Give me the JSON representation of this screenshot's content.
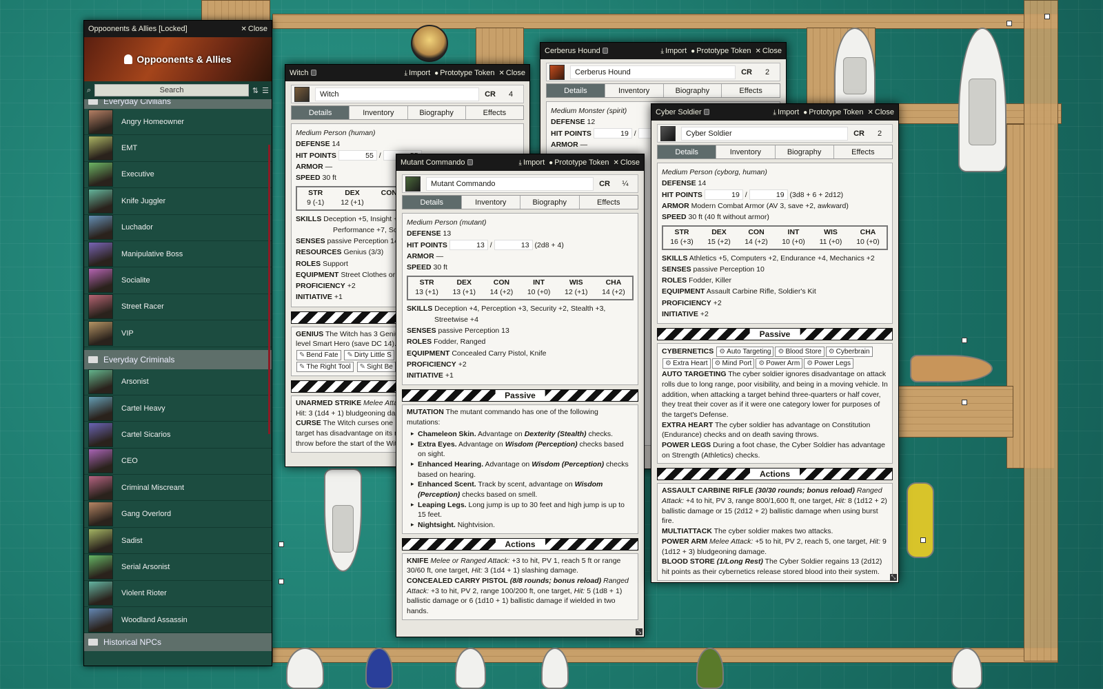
{
  "sidebar": {
    "title": "Oppoonents & Allies [Locked]",
    "close": "Close",
    "banner": "Oppoonents & Allies",
    "search_placeholder": "Search",
    "folder1": "Everyday Civilians",
    "civilians": [
      "Angry Homeowner",
      "EMT",
      "Executive",
      "Knife Juggler",
      "Luchador",
      "Manipulative Boss",
      "Socialite",
      "Street Racer",
      "VIP"
    ],
    "folder2": "Everyday Criminals",
    "criminals": [
      "Arsonist",
      "Cartel Heavy",
      "Cartel Sicarios",
      "CEO",
      "Criminal Miscreant",
      "Gang Overlord",
      "Sadist",
      "Serial Arsonist",
      "Violent Rioter",
      "Woodland Assassin"
    ],
    "folder3": "Historical NPCs"
  },
  "common": {
    "import": "Import",
    "prototype": "Prototype Token",
    "close": "Close",
    "cr": "CR",
    "tabs": [
      "Details",
      "Inventory",
      "Biography",
      "Effects"
    ]
  },
  "witch": {
    "title": "Witch",
    "name": "Witch",
    "cr": "4",
    "type": "Medium Person (human)",
    "defense": "14",
    "hp": "55",
    "hpmax": "55",
    "armor": "—",
    "speed": "30 ft",
    "abil": [
      [
        "STR",
        "9 (-1)"
      ],
      [
        "DEX",
        "12 (+1)"
      ],
      [
        "CON",
        ""
      ]
    ],
    "skills": "Deception +5, Insight +",
    "skills2": "Performance +7, Social",
    "senses": "passive Perception 14",
    "resources": "Genius (3/3)",
    "roles": "Support",
    "equipment": "Street Clothes or l",
    "proficiency": "+2",
    "initiative": "+1",
    "genius": "The Witch has 3 Genius",
    "genius2": "level Smart Hero (save DC 14). T",
    "chips": [
      "Bend Fate",
      "Dirty Little S",
      "The Right Tool",
      "Sight Be"
    ],
    "unarmed": "UNARMED STRIKE",
    "unarmed_t": "Melee Attac",
    "unarmed2": "Hit: 3 (1d4 + 1) bludgeoning da",
    "curse": "The Witch curses one",
    "curse2": "target has disadvantage on its n",
    "curse3": "throw before the start of the Wit"
  },
  "cerberus": {
    "title": "Cerberus Hound",
    "name": "Cerberus Hound",
    "cr": "2",
    "type": "Medium Monster (spirit)",
    "defense": "12",
    "hp": "19",
    "hpmax": "19",
    "armor": "—"
  },
  "mutant": {
    "title": "Mutant Commando",
    "name": "Mutant Commando",
    "cr": "¼",
    "type": "Medium Person (mutant)",
    "defense": "13",
    "hp": "13",
    "hpmax": "13",
    "hpdice": "(2d8 + 4)",
    "armor": "—",
    "speed": "30 ft",
    "abil": [
      [
        "STR",
        "13 (+1)"
      ],
      [
        "DEX",
        "13 (+1)"
      ],
      [
        "CON",
        "14 (+2)"
      ],
      [
        "INT",
        "10 (+0)"
      ],
      [
        "WIS",
        "12 (+1)"
      ],
      [
        "CHA",
        "14 (+2)"
      ]
    ],
    "skills": "Deception +4, Perception +3, Security +2, Stealth +3,",
    "skills2": "Streetwise +4",
    "senses": "passive Perception 13",
    "roles": "Fodder, Ranged",
    "equipment": "Concealed Carry Pistol, Knife",
    "proficiency": "+2",
    "initiative": "+1",
    "passive": "Passive",
    "mutation": "MUTATION",
    "mutation_t": "The mutant commando has one of the following mutations:",
    "muts": [
      [
        "Chameleon Skin.",
        "Advantage on ",
        "Dexterity (Stealth)",
        " checks."
      ],
      [
        "Extra Eyes.",
        "Advantage on ",
        "Wisdom (Perception)",
        " checks based on sight."
      ],
      [
        "Enhanced Hearing.",
        "Advantage on ",
        "Wisdom (Perception)",
        " checks based on hearing."
      ],
      [
        "Enhanced Scent.",
        "Track by scent, advantage on ",
        "Wisdom (Perception)",
        " checks based on smell."
      ],
      [
        "Leaping Legs.",
        "Long jump is up to 30 feet and high jump is up to 15 feet.",
        "",
        ""
      ],
      [
        "Nightsight.",
        "Nightvision.",
        "",
        ""
      ]
    ],
    "actions": "Actions",
    "knife": "KNIFE",
    "knife_t": "Melee or Ranged Attack:",
    "knife2": "+3 to hit, PV 1, reach 5 ft or range 30/60 ft, one target,",
    "knife3": "Hit:",
    "knife4": "3 (1d4 + 1) slashing damage.",
    "pistol": "CONCEALED CARRY PISTOL",
    "pistol_t": "(8/8 rounds; bonus reload)",
    "pistol_t2": "Ranged Attack:",
    "pistol2": "+3 to hit, PV 2, range 100/200 ft, one target,",
    "pistol3": "Hit:",
    "pistol4": "5 (1d8 + 1) ballistic damage or 6 (1d10 + 1) ballistic damage if wielded in two hands."
  },
  "cyber": {
    "title": "Cyber Soldier",
    "name": "Cyber Soldier",
    "cr": "2",
    "type": "Medium Person (cyborg, human)",
    "defense": "14",
    "hp": "19",
    "hpmax": "19",
    "hpdice": "(3d8 + 6 + 2d12)",
    "armor": "Modern Combat Armor (AV 3, save +2, awkward)",
    "speed": "30 ft (40 ft without armor)",
    "abil": [
      [
        "STR",
        "16 (+3)"
      ],
      [
        "DEX",
        "15 (+2)"
      ],
      [
        "CON",
        "14 (+2)"
      ],
      [
        "INT",
        "10 (+0)"
      ],
      [
        "WIS",
        "11 (+0)"
      ],
      [
        "CHA",
        "10 (+0)"
      ]
    ],
    "skills": "Athletics +5, Computers +2, Endurance +4, Mechanics +2",
    "senses": "passive Perception 10",
    "roles": "Fodder, Killer",
    "equipment": "Assault Carbine Rifle, Soldier's Kit",
    "proficiency": "+2",
    "initiative": "+2",
    "passive": "Passive",
    "cybernetics": "CYBERNETICS",
    "chips": [
      "Auto Targeting",
      "Blood Store",
      "Cyberbrain",
      "Extra Heart",
      "Mind Port",
      "Power Arm",
      "Power Legs"
    ],
    "auto": "AUTO TARGETING",
    "auto_t": "The cyber soldier ignores disadvantage on attack rolls due to long range, poor visibility, and being in a moving vehicle. In addition, when attacking a target behind three-quarters or half cover, they treat their cover as if it were one category lower for purposes of the target's Defense.",
    "heart": "EXTRA HEART",
    "heart_t": "The cyber soldier has advantage on Constitution (Endurance) checks and on death saving throws.",
    "legs": "POWER LEGS",
    "legs_t": "During a foot chase, the Cyber Soldier has advantage on Strength (Athletics) checks.",
    "actions": "Actions",
    "rifle": "ASSAULT CARBINE RIFLE",
    "rifle_t": "(30/30 rounds; bonus reload)",
    "rifle_t2": "Ranged Attack:",
    "rifle2": "+4 to hit, PV 3, range 800/1,600 ft, one target,",
    "rifle3": "Hit:",
    "rifle4": "8 (1d12 + 2) ballistic damage or 15 (2d12 + 2) ballistic damage when using burst fire.",
    "multi": "MULTIATTACK",
    "multi_t": "The cyber soldier makes two attacks.",
    "arm": "POWER ARM",
    "arm_t": "Melee Attack:",
    "arm2": "+5 to hit, PV 2, reach 5, one target,",
    "arm3": "Hit:",
    "arm4": "9 (1d12 + 3) bludgeoning damage.",
    "blood": "BLOOD STORE",
    "blood_t": "(1/Long Rest)",
    "blood2": "The Cyber Soldier regains 13 (2d12) hit points as their cybernetics release stored blood into their system."
  }
}
